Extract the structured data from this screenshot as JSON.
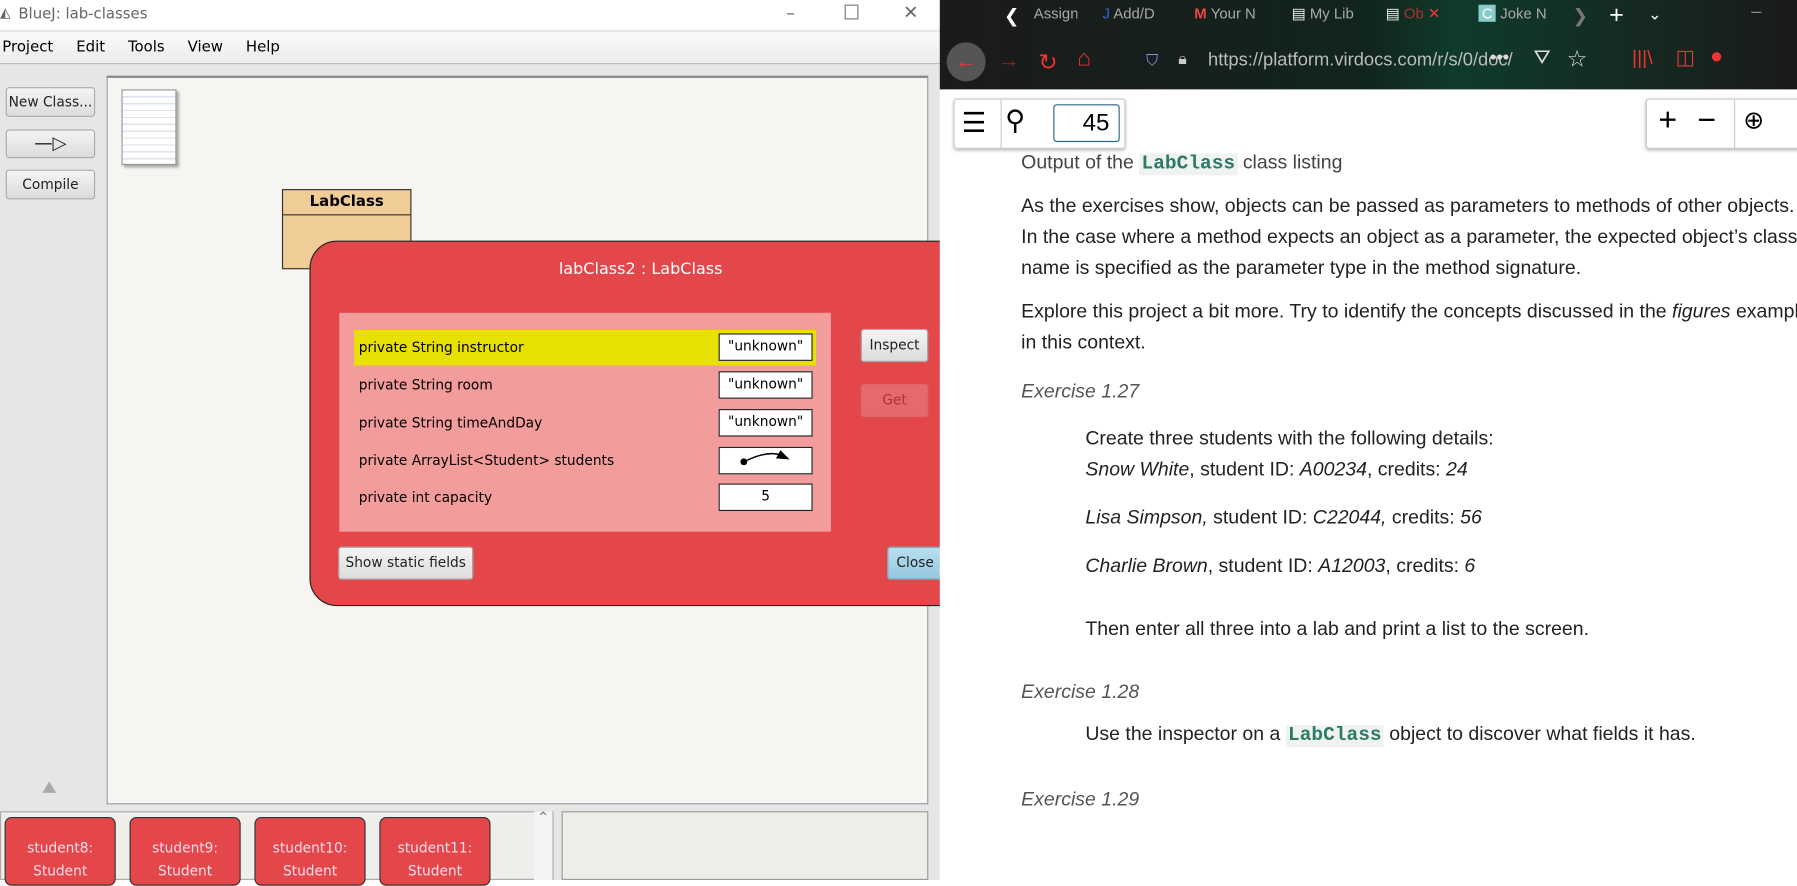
{
  "bluej": {
    "title": "BlueJ:  lab-classes",
    "menu": [
      "Project",
      "Edit",
      "Tools",
      "View",
      "Help"
    ],
    "toolbar": {
      "new_class": "New Class...",
      "compile": "Compile"
    },
    "class_box": "LabClass",
    "objects": [
      {
        "name": "student8:",
        "type": "Student"
      },
      {
        "name": "student9:",
        "type": "Student"
      },
      {
        "name": "student10:",
        "type": "Student"
      },
      {
        "name": "student11:",
        "type": "Student"
      }
    ]
  },
  "inspector": {
    "title": "labClass2 : LabClass",
    "fields": [
      {
        "label": "private String instructor",
        "value": "\"unknown\""
      },
      {
        "label": "private String room",
        "value": "\"unknown\""
      },
      {
        "label": "private String timeAndDay",
        "value": "\"unknown\""
      },
      {
        "label": "private ArrayList<Student> students",
        "value": ""
      },
      {
        "label": "private int capacity",
        "value": "5"
      }
    ],
    "inspect": "Inspect",
    "get": "Get",
    "show_static": "Show static fields",
    "close": "Close"
  },
  "browser": {
    "tabs": [
      "Assign",
      "Add/D",
      "Your N",
      "My Lib",
      "Ob",
      "Joke N"
    ],
    "url": "https://platform.virdocs.com/r/s/0/doc/",
    "page": "45"
  },
  "doc": {
    "caption_pre": "Output of the",
    "caption_code": "LabClass",
    "caption_post": "class listing",
    "p1": "As the exercises show, objects can be passed as parameters to methods of other objects. In the case where a method expects an object as a parameter, the expected object’s class name is specified as the parameter type in the method signature.",
    "p2_pre": "Explore this project a bit more. Try to identify the concepts discussed in the",
    "p2_em": "figures",
    "p2_post": "example in this context.",
    "ex127": "Exercise 1.27",
    "ex127_intro": "Create three students with the following details:",
    "students": [
      {
        "name": "Snow White",
        "id_label": ", student ID: ",
        "id": "A00234",
        "cr_label": ", credits: ",
        "credits": "24"
      },
      {
        "name": "Lisa Simpson,",
        "id_label": " student ID: ",
        "id": "C22044,",
        "cr_label": " credits: ",
        "credits": "56"
      },
      {
        "name": "Charlie Brown",
        "id_label": ", student ID: ",
        "id": "A12003",
        "cr_label": ", credits: ",
        "credits": "6"
      }
    ],
    "ex127_tail": "Then enter all three into a lab and print a list to the screen.",
    "ex128": "Exercise 1.28",
    "ex128_pre": "Use the inspector on a",
    "ex128_code": "LabClass",
    "ex128_post": "object to discover what fields it has.",
    "ex129": "Exercise 1.29"
  }
}
